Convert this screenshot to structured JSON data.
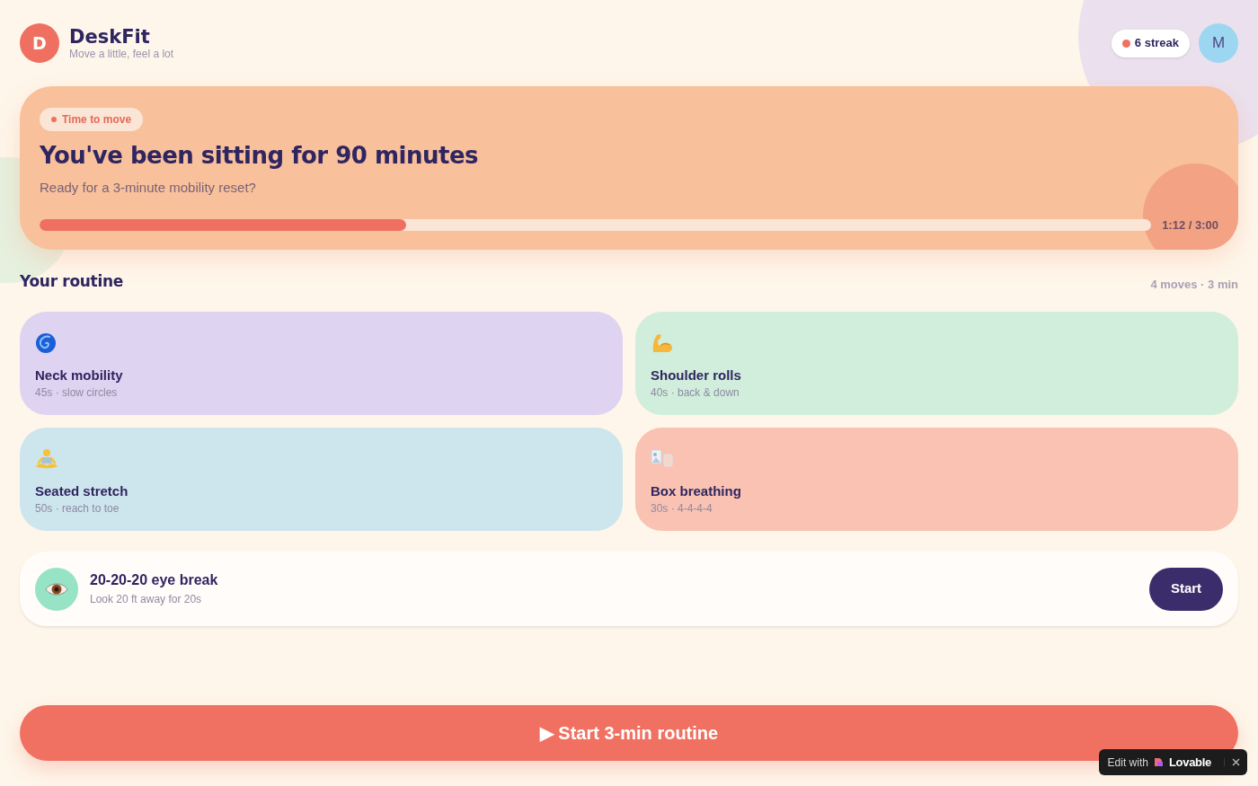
{
  "app": {
    "logo_letter": "D",
    "name": "DeskFit",
    "tagline": "Move a little, feel a lot"
  },
  "header": {
    "streak": "6 streak",
    "avatar_letter": "M"
  },
  "hero": {
    "badge": "Time to move",
    "title": "You've been sitting for 90 minutes",
    "subtitle": "Ready for a 3-minute mobility reset?",
    "level": 0.33,
    "time": "1:12 / 3:00"
  },
  "routine": {
    "title": "Your routine",
    "summary": "4 moves · 3 min",
    "cards": [
      {
        "title": "Neck mobility",
        "detail": "45s · slow circles",
        "color": "#ded3f0"
      },
      {
        "title": "Shoulder rolls",
        "detail": "40s · back & down",
        "color": "#d0eedb"
      },
      {
        "title": "Seated stretch",
        "detail": "50s · reach to toe",
        "color": "#cde5ec"
      },
      {
        "title": "Box breathing",
        "detail": "30s · 4-4-4-4",
        "color": "#f9c2b2"
      }
    ]
  },
  "eye_break": {
    "title": "20-20-20 eye break",
    "subtitle": "Look 20 ft away for 20s",
    "button": "Start"
  },
  "main_button": "▶ Start 3-min routine",
  "badge": {
    "prefix": "Edit with",
    "brand": "Lovable"
  }
}
